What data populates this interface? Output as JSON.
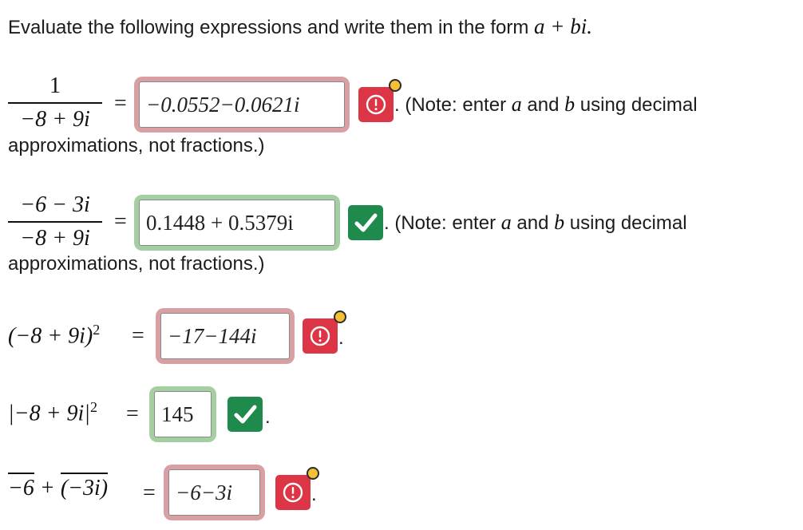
{
  "prompt": {
    "text": "Evaluate the following expressions and write them in the form ",
    "math": "a + bi."
  },
  "note_text": {
    "prefix": ". (Note: enter ",
    "a": "a",
    "and": " and ",
    "b": "b",
    "suffix": " using decimal",
    "line2": "approximations, not fractions.)"
  },
  "problems": [
    {
      "expr": {
        "numerator": "1",
        "denominator": "−8 + 9i"
      },
      "equals": "=",
      "answer": "−0.0552−0.0621i",
      "status": "incorrect",
      "has_note": true
    },
    {
      "expr": {
        "numerator": "−6 − 3i",
        "denominator": "−8 + 9i"
      },
      "equals": "=",
      "answer": "0.1448 + 0.5379i",
      "status": "correct",
      "has_note": true
    },
    {
      "expr": {
        "text": "(−8 + 9i)",
        "sup": "2"
      },
      "equals": "=",
      "answer": "−17−144i",
      "status": "incorrect",
      "trail": "."
    },
    {
      "expr": {
        "text": "|−8 + 9i|",
        "sup": "2"
      },
      "equals": "=",
      "answer": "145",
      "status": "correct",
      "trail": "."
    },
    {
      "expr": {
        "part1": "−6",
        "plus": " + ",
        "part2": "(−3i)"
      },
      "equals": "=",
      "answer": "−6−3i",
      "status": "incorrect",
      "trail": "."
    }
  ],
  "icons": {
    "incorrect": "exclamation-circle-icon",
    "correct": "checkmark-icon",
    "indicator": "yellow-dot-icon"
  },
  "colors": {
    "incorrect_frame": "#d9a0a4",
    "correct_frame": "#a5cfa0",
    "incorrect_badge": "#dc3545",
    "correct_badge": "#1e8a4c",
    "indicator_dot": "#f6c035"
  }
}
